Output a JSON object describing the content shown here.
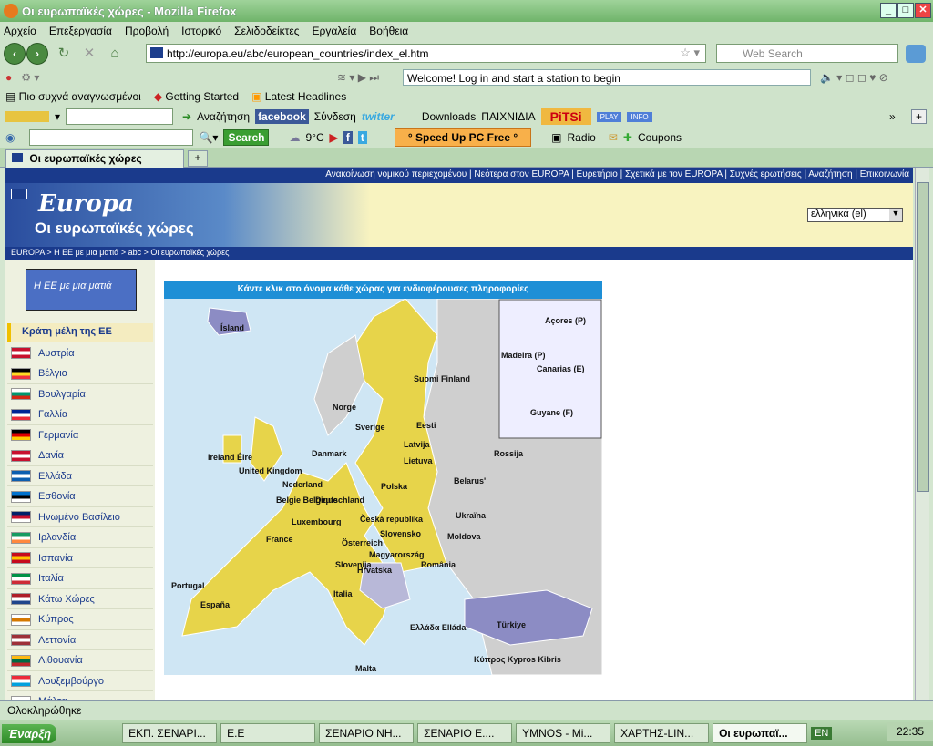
{
  "window": {
    "title": "Οι ευρωπαϊκές χώρες - Mozilla Firefox"
  },
  "menu": [
    "Αρχείο",
    "Επεξεργασία",
    "Προβολή",
    "Ιστορικό",
    "Σελιδοδείκτες",
    "Εργαλεία",
    "Βοήθεια"
  ],
  "nav": {
    "url": "http://europa.eu/abc/european_countries/index_el.htm",
    "search_placeholder": "Web Search"
  },
  "toolbar1": {
    "welcome": "Welcome! Log in and start a station to begin"
  },
  "bookmarks": [
    "Πιο συχνά αναγνωσμένοι",
    "Getting Started",
    "Latest Headlines"
  ],
  "toolbar2": {
    "search_label": "Αναζήτηση",
    "facebook": "facebook",
    "login": "Σύνδεση",
    "twitter": "twitter",
    "downloads": "Downloads",
    "games": "ΠΑΙΧΝΙΔΙΑ",
    "pitsi": "PiTSi",
    "play": "PLAY",
    "info": "INFO"
  },
  "toolbar3": {
    "search_button": "Search",
    "temp": "9°C",
    "speedup": "° Speed Up PC Free °",
    "radio": "Radio",
    "coupons": "Coupons"
  },
  "tab": {
    "title": "Οι ευρωπαϊκές χώρες"
  },
  "page": {
    "top_links": "Ανακοίνωση νομικού περιεχομένου | Νεότερα στον EUROPA | Ευρετήριο | Σχετικά με τον EUROPA | Συχνές ερωτήσεις | Αναζήτηση | Επικοινωνία",
    "europa_logo": "Europa",
    "banner_title": "Οι ευρωπαϊκές χώρες",
    "language": "ελληνικά (el)",
    "breadcrumb": "EUROPA > Η ΕΕ με μια ματιά > abc > Οι ευρωπαϊκές χώρες",
    "ee_box": "Η ΕΕ με μια ματιά",
    "member_header": "Κράτη μέλη της ΕΕ",
    "countries": [
      "Αυστρία",
      "Βέλγιο",
      "Βουλγαρία",
      "Γαλλία",
      "Γερμανία",
      "Δανία",
      "Ελλάδα",
      "Εσθονία",
      "Ηνωμένο Βασίλειο",
      "Ιρλανδία",
      "Ισπανία",
      "Ιταλία",
      "Κάτω Χώρες",
      "Κύπρος",
      "Λεττονία",
      "Λιθουανία",
      "Λουξεμβούργο",
      "Μάλτα"
    ],
    "map_header": "Κάντε κλικ στο όνομα κάθε χώρας για ενδιαφέρουσες πληροφορίες",
    "map_labels": [
      "Ísland",
      "Suomi Finland",
      "Norge",
      "Sverige",
      "Eesti",
      "Latvija",
      "Lietuva",
      "Danmark",
      "Ireland Éire",
      "United Kingdom",
      "Nederland",
      "Belgie Belgique",
      "Deutschland",
      "Polska",
      "Luxembourg",
      "Česká republika",
      "Slovensko",
      "France",
      "Österreich",
      "Magyarország",
      "România",
      "Slovenija",
      "Hrvatska",
      "Italia",
      "España",
      "Portugal",
      "Ελλάδα Elláda",
      "Türkiye",
      "Κύπρος Kypros Kibris",
      "Malta",
      "Rossija",
      "Ukraїna",
      "Belarus'",
      "Moldova",
      "Açores (P)",
      "Madeira (P)",
      "Canarias (E)",
      "Guyane (F)"
    ]
  },
  "status": "Ολοκληρώθηκε",
  "taskbar": {
    "start": "Έναρξη",
    "items": [
      "ΕΚΠ. ΣΕΝΑΡΙ...",
      "Ε.Ε",
      "ΣΕΝΑΡΙΟ ΝΗ...",
      "ΣΕΝΑΡΙΟ Ε....",
      "YMNOS - Mi...",
      "ΧΑΡΤΗΣ-LIN...",
      "Οι ευρωπαϊ..."
    ],
    "lang": "EN",
    "clock": "22:35"
  }
}
